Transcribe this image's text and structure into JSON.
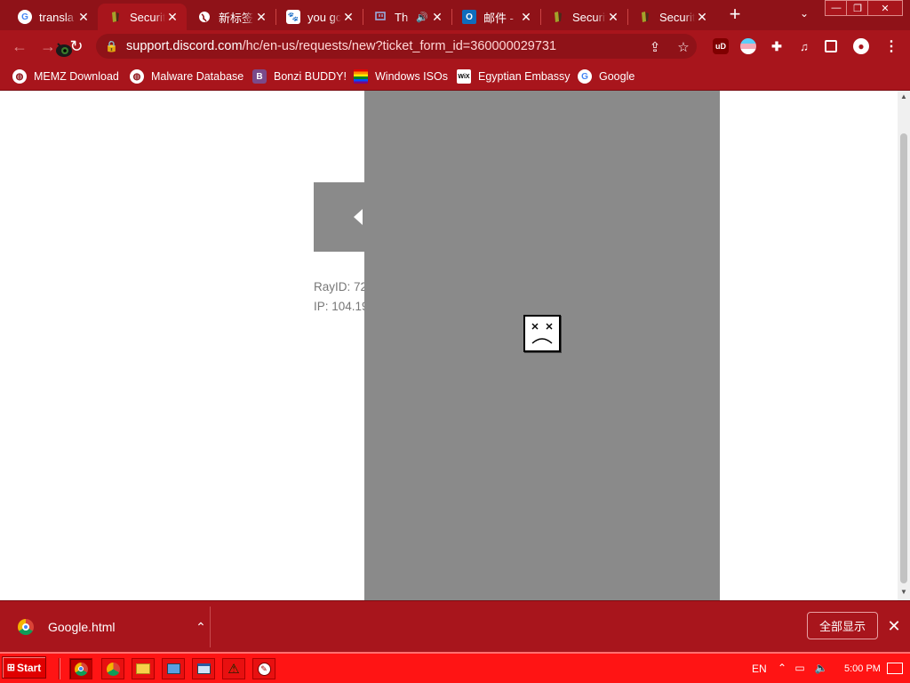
{
  "browser": {
    "tabs": [
      {
        "label": "transla",
        "icon": "google-icon"
      },
      {
        "label": "Securit",
        "icon": "security-page-icon",
        "active": true
      },
      {
        "label": "新标签",
        "icon": "globe-icon"
      },
      {
        "label": "you gc",
        "icon": "baidu-paw-icon"
      },
      {
        "label": "Th",
        "icon": "twitch-icon",
        "audio": true
      },
      {
        "label": "邮件 -",
        "icon": "outlook-icon"
      },
      {
        "label": "Securit",
        "icon": "security-page-icon"
      },
      {
        "label": "Securit",
        "icon": "security-page-icon"
      }
    ],
    "url_host": "support.discord.com",
    "url_path": "/hc/en-us/requests/new?ticket_form_id=360000029731",
    "bookmarks": [
      {
        "label": "MEMZ Download",
        "icon": "globe-icon"
      },
      {
        "label": "Malware Database",
        "icon": "globe-icon"
      },
      {
        "label": "Bonzi BUDDY!",
        "icon": "bonzi-icon"
      },
      {
        "label": "Windows ISOs",
        "icon": "rainbow-flag-icon"
      },
      {
        "label": "Egyptian Embassy",
        "icon": "wix-icon"
      },
      {
        "label": "Google",
        "icon": "google-icon"
      }
    ],
    "extensions": {
      "ublock": "uD"
    }
  },
  "page": {
    "ray_id": "RayID: 72",
    "ip": "IP: 104.19"
  },
  "download_shelf": {
    "file_name": "Google.html",
    "show_all": "全部显示"
  },
  "taskbar": {
    "start_label": "Start",
    "language": "EN",
    "time": "5:00 PM"
  },
  "colors": {
    "chrome_dark": "#8f1218",
    "chrome_main": "#a8151c",
    "taskbar": "#ff1414",
    "overlay": "#8a8a8a"
  }
}
